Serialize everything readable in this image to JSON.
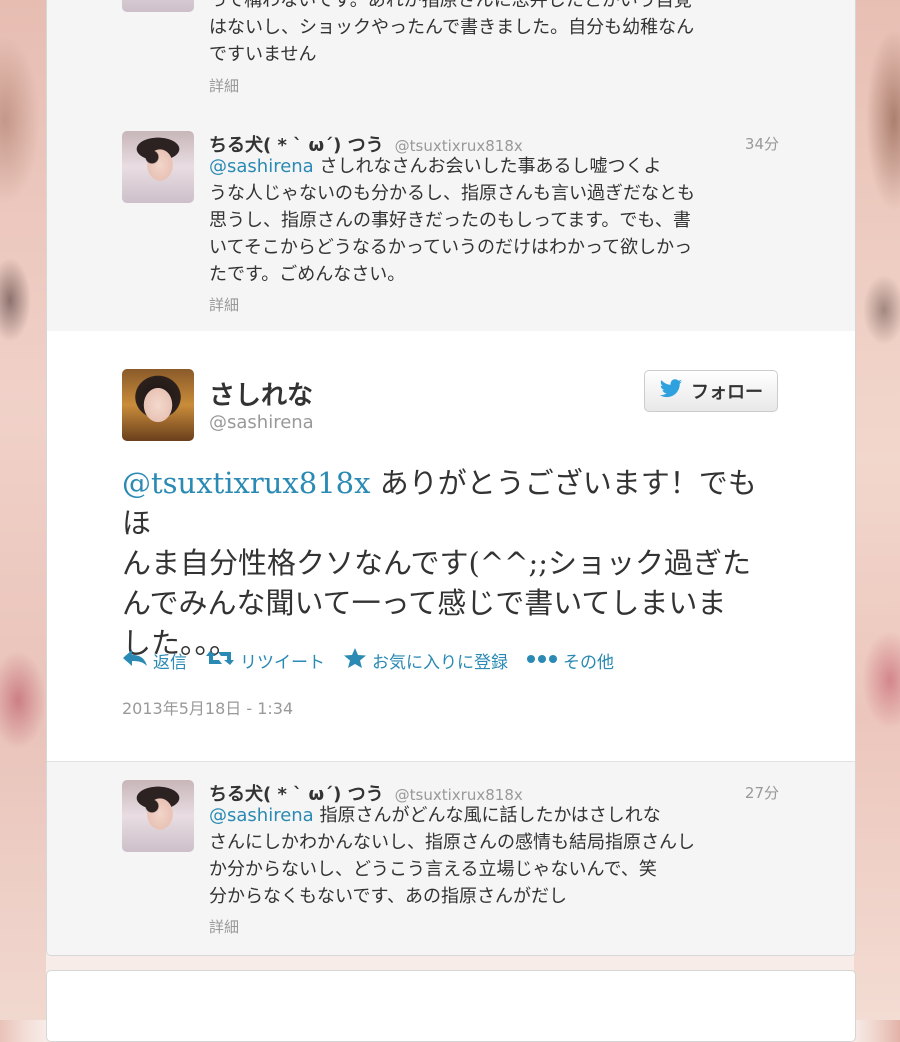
{
  "tweets_above": [
    {
      "text_lines": [
        "って構わないです。あれが指原さんに忠弁したとかいう自覚",
        "はないし、ショックやったんで書きました。自分も幼稚なん",
        "ですいません"
      ],
      "detail": "詳細"
    },
    {
      "name": "ちる犬( * ` ω´) つう",
      "handle": "@tsuxtixrux818x",
      "time": "34分",
      "mention": "@sashirena",
      "text_lines": [
        "さしれなさんお会いした事あるし嘘つくよ",
        "うな人じゃないのも分かるし、指原さんも言い過ぎだなとも",
        "思うし、指原さんの事好きだったのもしってます。でも、書",
        "いてそこからどうなるかっていうのだけはわかって欲しかっ",
        "たです。ごめんなさい。"
      ],
      "detail": "詳細"
    }
  ],
  "main_tweet": {
    "name": "さしれな",
    "handle": "@sashirena",
    "follow_label": "フォロー",
    "mention": "@tsuxtixrux818x",
    "text_lines": [
      "ありがとうございます！でもほ",
      "んま自分性格クソなんです(^^;;ショック過ぎた",
      "んでみんな聞いて一って感じで書いてしまいま",
      "した。。。"
    ],
    "actions": {
      "reply": "返信",
      "retweet": "リツイート",
      "favorite": "お気に入りに登録",
      "more": "その他"
    },
    "timestamp": "2013年5月18日 - 1:34"
  },
  "tweets_below": [
    {
      "name": "ちる犬( * ` ω´) つう",
      "handle": "@tsuxtixrux818x",
      "time": "27分",
      "mention": "@sashirena",
      "text_lines": [
        "指原さんがどんな風に話したかはさしれな",
        "さんにしかわかんないし、指原さんの感情も結局指原さんし",
        "か分からないし、どうこう言える立場じゃないんで、笑",
        "分からなくもないです、あの指原さんがだし"
      ],
      "detail": "詳細"
    }
  ],
  "colors": {
    "link": "#2a8ab3",
    "twitter_bird": "#2ea1de"
  }
}
